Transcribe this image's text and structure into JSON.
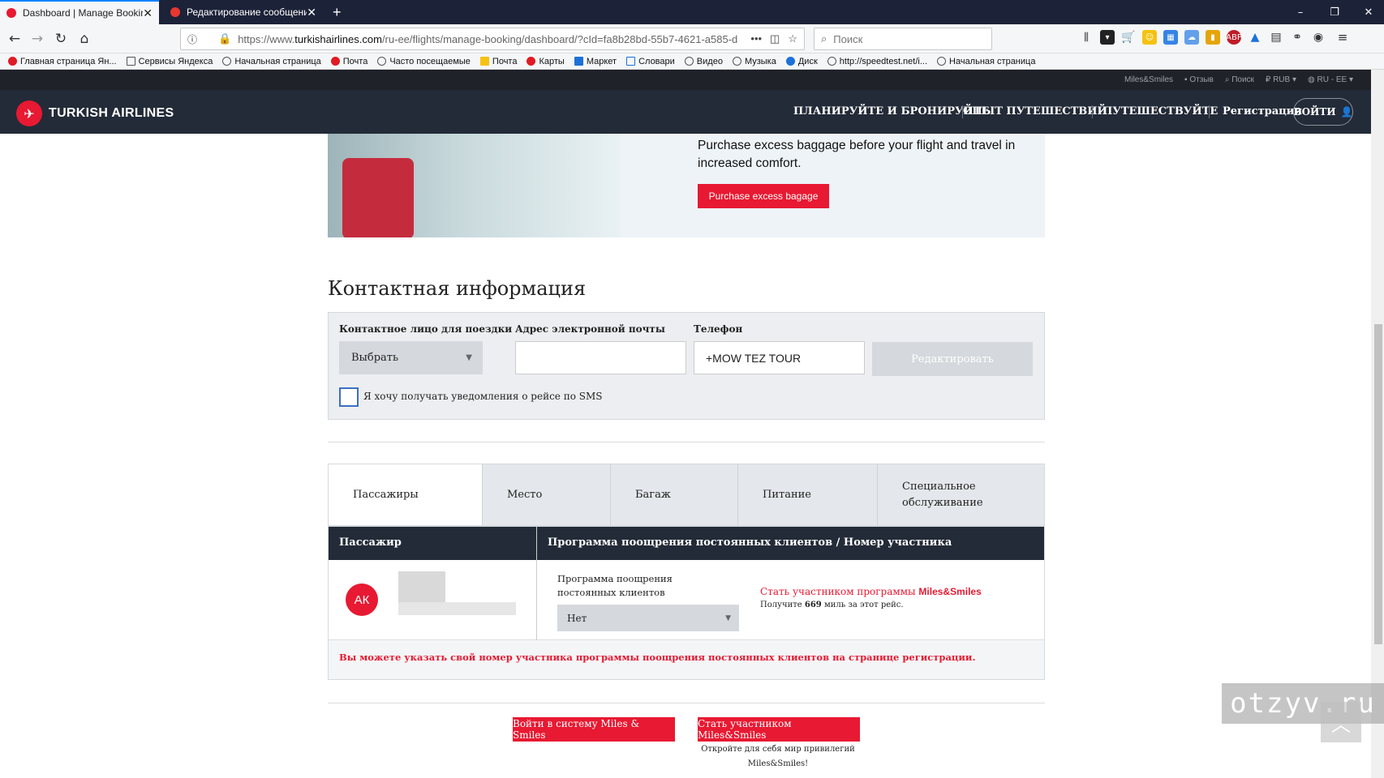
{
  "browser": {
    "tabs": [
      {
        "title": "Dashboard | Manage Booking |",
        "active": true
      },
      {
        "title": "Редактирование сообщения",
        "active": false
      }
    ],
    "new_tab": "+",
    "url_prefix": "https://www.",
    "url_domain": "turkishairlines.com",
    "url_path": "/ru-ee/flights/manage-booking/dashboard/?cId=fa8b28bd-55b7-4621-a585-d",
    "search_placeholder": "Поиск",
    "bookmarks": [
      "Главная страница Ян...",
      "Сервисы Яндекса",
      "Начальная страница",
      "Почта",
      "Часто посещаемые",
      "Почта",
      "Карты",
      "Маркет",
      "Словари",
      "Видео",
      "Музыка",
      "Диск",
      "http://speedtest.net/i...",
      "Начальная страница"
    ]
  },
  "site": {
    "util": {
      "miles": "Miles&Smiles",
      "feedback": "Отзыв",
      "search": "Поиск",
      "currency": "RUB",
      "locale": "RU - EE"
    },
    "logo": "TURKISH AIRLINES",
    "nav": [
      "ПЛАНИРУЙТЕ И БРОНИРУЙТЕ",
      "ОПЫТ ПУТЕШЕСТВИЙ",
      "ПУТЕШЕСТВУЙТЕ",
      "Регистрация"
    ],
    "login": "ВОЙТИ"
  },
  "promo": {
    "text": "Purchase excess baggage before your flight and travel in increased comfort.",
    "button": "Purchase excess bagage"
  },
  "contact": {
    "title": "Контактная информация",
    "person_label": "Контактное лицо для поездки",
    "person_value": "Выбрать",
    "email_label": "Адрес электронной почты",
    "email_value": "",
    "phone_label": "Телефон",
    "phone_value": "+MOW TEZ TOUR",
    "edit_button": "Редактировать",
    "sms_label": "Я хочу получать уведомления о рейсе по SMS"
  },
  "tabs": [
    "Пассажиры",
    "Место",
    "Багаж",
    "Питание",
    "Специальное обслуживание"
  ],
  "table": {
    "col_passenger": "Пассажир",
    "col_program": "Программа поощрения постоянных клиентов  /  Номер участника",
    "avatar": "АК",
    "program_label": "Программа поощрения постоянных клиентов",
    "program_value": "Нет",
    "join_text": "Стать участником программы ",
    "join_brand": "Miles&Smiles",
    "miles_pre": "Получите ",
    "miles_count": "669",
    "miles_post": " миль за этот рейс.",
    "warning": "Вы можете указать свой номер участника программы поощрения постоянных клиентов на странице регистрации."
  },
  "bottom": {
    "login_button": "Войти в систему Miles & Smiles",
    "join_button": "Стать участником Miles&Smiles",
    "tagline": "Откройте для себя мир привилегий Miles&Smiles!"
  },
  "watermark": "otzyv.ru"
}
